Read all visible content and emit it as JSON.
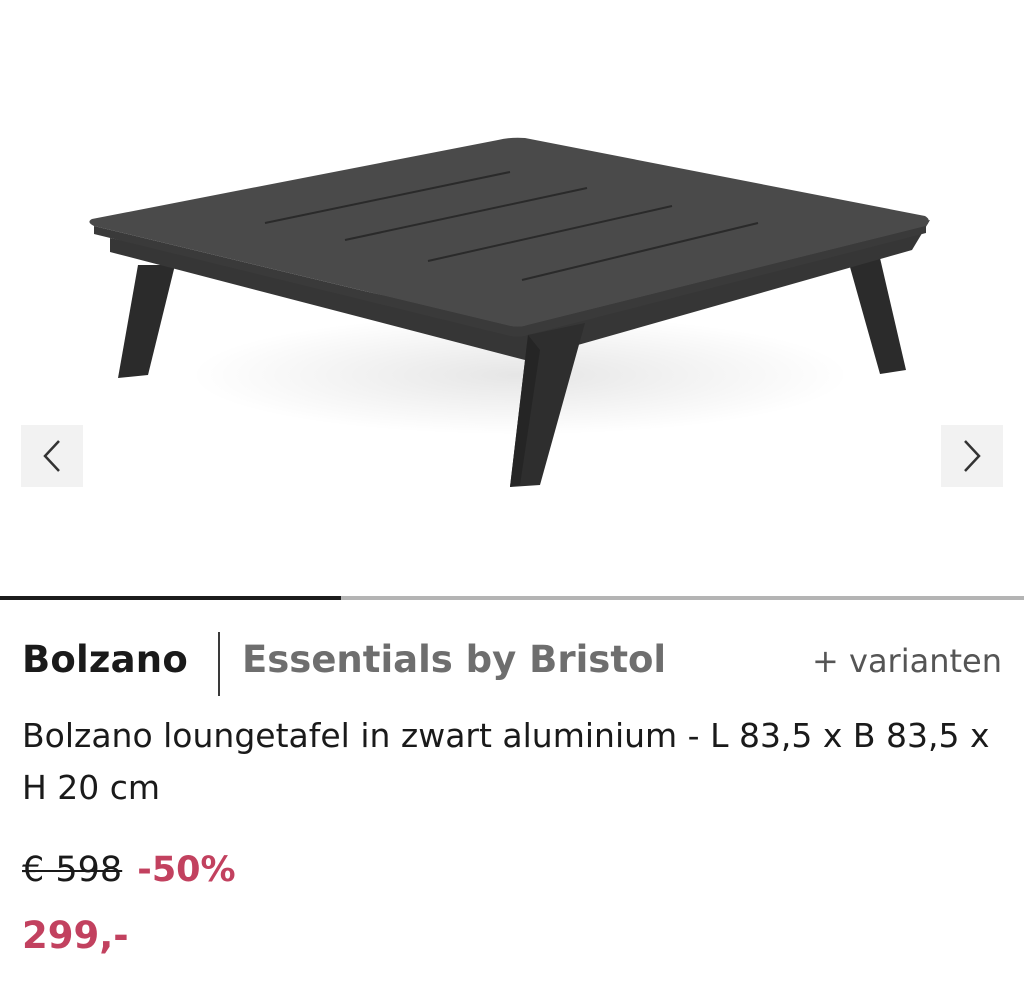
{
  "gallery": {
    "image_alt": "Bolzano loungetafel",
    "progress_fraction": 0.333
  },
  "product": {
    "brand": "Bolzano",
    "collection": "Essentials by Bristol",
    "variants_label": "+ varianten",
    "title": "Bolzano loungetafel in zwart aluminium - L 83,5 x B 83,5 x H 20 cm"
  },
  "price": {
    "old": "€ 598",
    "discount": "-50%",
    "new": "299,-"
  },
  "colors": {
    "accent": "#c2415f",
    "text": "#1a1a1a",
    "muted": "#6e6e6e"
  },
  "icons": {
    "prev": "chevron-left-icon",
    "next": "chevron-right-icon"
  }
}
